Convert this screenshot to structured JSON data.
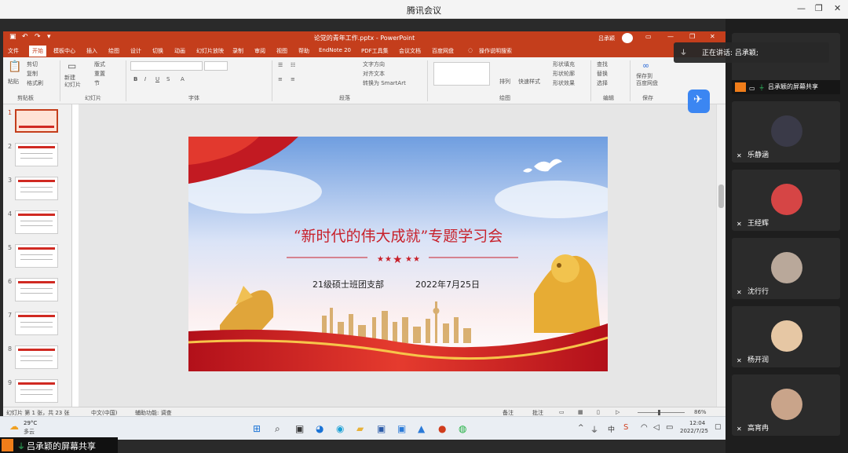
{
  "meeting": {
    "title": "腾讯会议",
    "speaking_label": "正在讲话: 吕承颖;",
    "share_label": "吕承颖的屏幕共享",
    "share_tile_label": "吕承颖的屏幕共享"
  },
  "ppt": {
    "filename": "论党的青年工作.pptx  -  PowerPoint",
    "user": "吕承颖",
    "tabs": [
      "文件",
      "开始",
      "模板中心",
      "插入",
      "绘图",
      "设计",
      "切换",
      "动画",
      "幻灯片放映",
      "录制",
      "审阅",
      "视图",
      "帮助",
      "EndNote 20",
      "PDF工具集",
      "会议文档",
      "百度网盘",
      "操作说明搜索"
    ],
    "active_tab": "开始",
    "ribbon_groups": [
      "剪贴板",
      "幻灯片",
      "字体",
      "段落",
      "绘图",
      "编辑",
      "保存"
    ],
    "ribbon_items": {
      "paste": "粘贴",
      "cut": "剪切",
      "copy": "复制",
      "format_painter": "格式刷",
      "new_slide": "新建\n幻灯片",
      "layout": "版式",
      "reset": "重置",
      "section": "节",
      "text_direction": "文字方向",
      "align_text": "对齐文本",
      "smartart": "转换为 SmartArt",
      "arrange": "排列",
      "quick_styles": "快速样式",
      "shape_fill": "形状填充",
      "shape_outline": "形状轮廓",
      "shape_effects": "形状效果",
      "find": "查找",
      "replace": "替换",
      "select": "选择",
      "save_baidu": "保存到\n百度网盘"
    },
    "thumbnail_numbers": [
      "1",
      "2",
      "3",
      "4",
      "5",
      "6",
      "7",
      "8",
      "9"
    ],
    "status": {
      "slide_info": "幻灯片 第 1 张，共 23 张",
      "language": "中文(中国)",
      "accessibility": "辅助功能: 调查",
      "notes": "备注",
      "comments": "批注",
      "zoom": "86%"
    }
  },
  "slide": {
    "title": "“新时代的伟大成就”专题学习会",
    "org": "21级硕士班团支部",
    "date": "2022年7月25日"
  },
  "taskbar": {
    "weather_temp": "29°C",
    "weather_desc": "多云",
    "ime": "中",
    "time": "12:04",
    "date": "2022/7/25"
  },
  "participants": [
    {
      "name": "乐静涵"
    },
    {
      "name": "王经辉"
    },
    {
      "name": "沈行行"
    },
    {
      "name": "杨开润"
    },
    {
      "name": "高宵冉"
    }
  ],
  "colors": {
    "ppt_red": "#c43e1c",
    "slide_title_red": "#c8202a",
    "share_orange": "#f07d1a"
  }
}
